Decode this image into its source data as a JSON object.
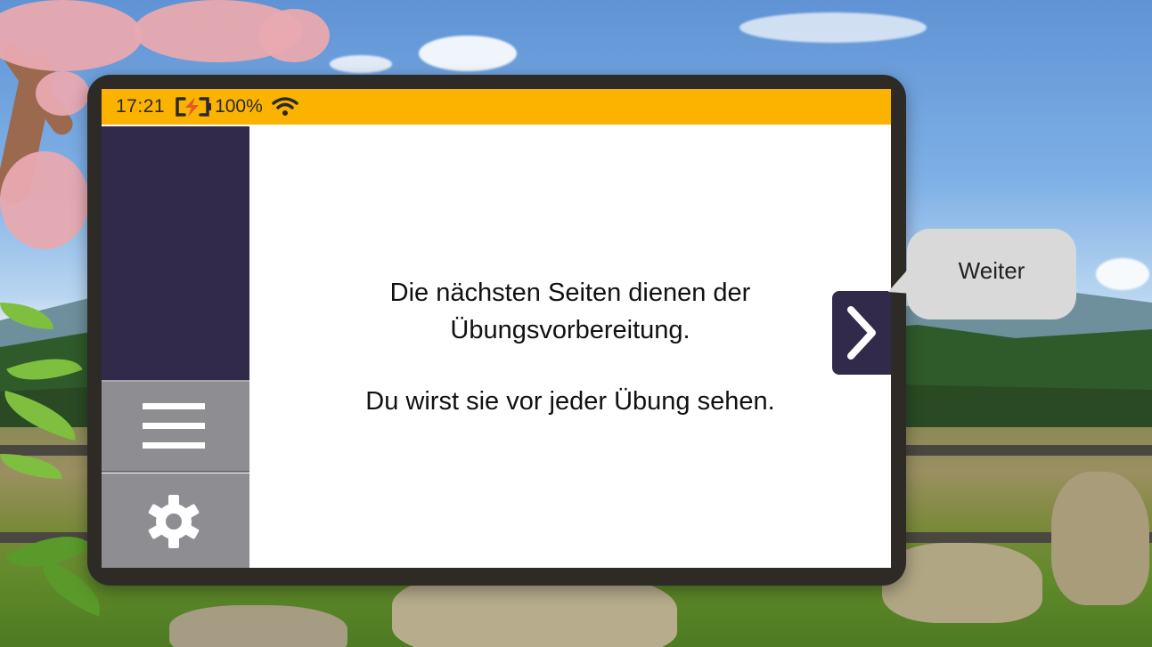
{
  "status_bar": {
    "time": "17:21",
    "battery_percent": "100%",
    "battery_icon": "battery-charging-icon",
    "wifi_icon": "wifi-icon"
  },
  "sidebar": {
    "menu_icon": "hamburger-menu-icon",
    "settings_icon": "gear-icon"
  },
  "content": {
    "line1": "Die nächsten Seiten dienen der",
    "line2": "Übungsvorbereitung.",
    "line3": "Du wirst sie vor jeder Übung sehen."
  },
  "navigation": {
    "next_icon": "chevron-right-icon",
    "tooltip": "Weiter"
  },
  "colors": {
    "status_bar": "#fbb300",
    "sidebar_dark": "#312a4b",
    "sidebar_gray": "#8d8d92",
    "tablet_frame": "#2e2a26"
  }
}
